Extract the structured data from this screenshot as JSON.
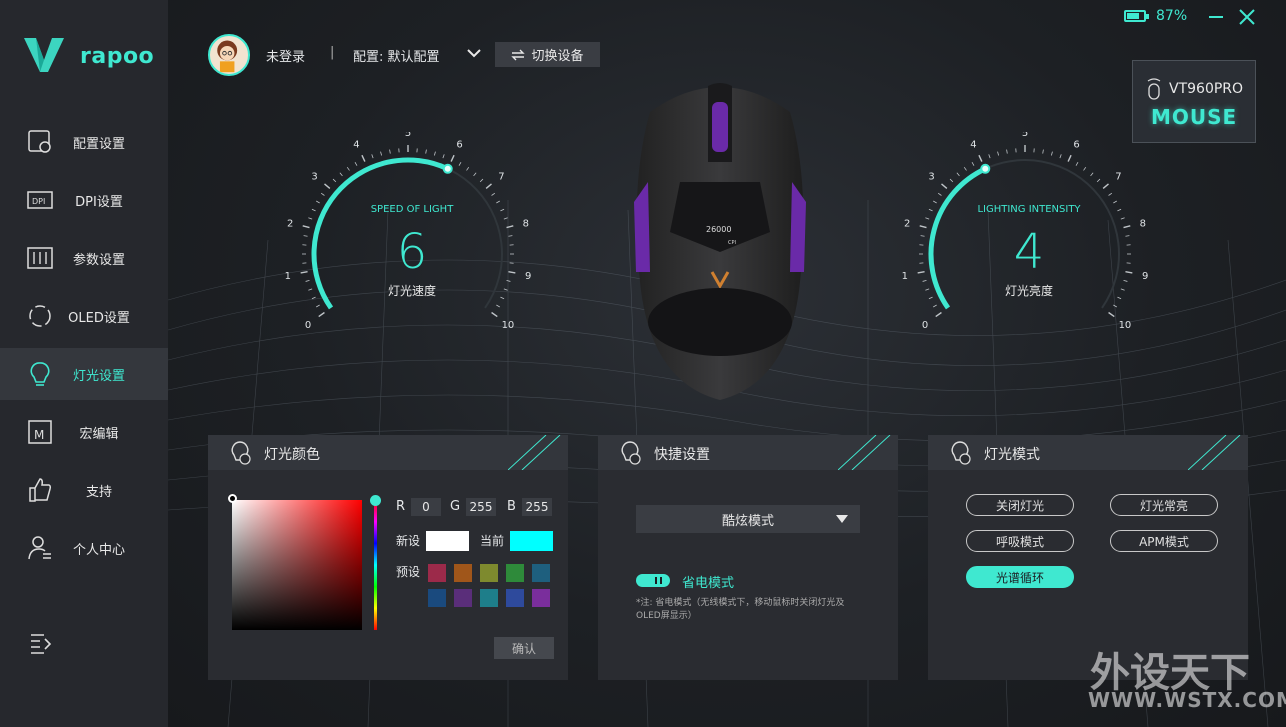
{
  "app": {
    "logo_text": "rapoo"
  },
  "sidebar": {
    "items": [
      {
        "label": "配置设置",
        "icon": "profile-settings-icon"
      },
      {
        "label": "DPI设置",
        "icon": "dpi-icon"
      },
      {
        "label": "参数设置",
        "icon": "sliders-icon"
      },
      {
        "label": "OLED设置",
        "icon": "oled-icon"
      },
      {
        "label": "灯光设置",
        "icon": "bulb-icon",
        "active": true
      },
      {
        "label": "宏编辑",
        "icon": "macro-icon"
      },
      {
        "label": "支持",
        "icon": "thumbs-up-icon"
      },
      {
        "label": "个人中心",
        "icon": "user-icon"
      }
    ]
  },
  "topbar": {
    "battery_pct": "87%",
    "battery_level": 0.87
  },
  "header": {
    "user_name": "未登录",
    "separator": "|",
    "profile_label": "配置: 默认配置",
    "switch_device": "切换设备"
  },
  "device": {
    "model": "VT960PRO",
    "type": "MOUSE"
  },
  "speed_gauge": {
    "title": "SPEED OF LIGHT",
    "value": "6",
    "label": "灯光速度",
    "ticks": [
      "0",
      "1",
      "2",
      "3",
      "4",
      "5",
      "6",
      "7",
      "8",
      "9",
      "10"
    ],
    "level": 6
  },
  "intensity_gauge": {
    "title": "LIGHTING INTENSITY",
    "value": "4",
    "label": "灯光亮度",
    "ticks": [
      "0",
      "1",
      "2",
      "3",
      "4",
      "5",
      "6",
      "7",
      "8",
      "9",
      "10"
    ],
    "level": 4
  },
  "mouse_screen": {
    "dpi": "26000",
    "unit": "CPI"
  },
  "color_panel": {
    "title": "灯光颜色",
    "r_label": "R",
    "r": "0",
    "g_label": "G",
    "g": "255",
    "b_label": "B",
    "b": "255",
    "new_label": "新设",
    "current_label": "当前",
    "new_color": "#ffffff",
    "current_color": "#00ffff",
    "preset_label": "预设",
    "presets": [
      "#9c2a4a",
      "#a0561a",
      "#7e8a2e",
      "#2e8a3a",
      "#1e5f7e",
      "#1a4a7e",
      "#5a2e7a",
      "#1e7e8a",
      "#2e4a9c",
      "#7a2e9c"
    ],
    "confirm": "确认"
  },
  "shortcut_panel": {
    "title": "快捷设置",
    "mode_selected": "酷炫模式",
    "power_save": "省电模式",
    "note": "*注: 省电模式（无线模式下，移动鼠标时关闭灯光及OLED屏显示）"
  },
  "light_mode_panel": {
    "title": "灯光模式",
    "modes": [
      {
        "label": "关闭灯光"
      },
      {
        "label": "灯光常亮"
      },
      {
        "label": "呼吸模式"
      },
      {
        "label": "APM模式"
      },
      {
        "label": "光谱循环",
        "active": true
      }
    ]
  },
  "watermark": {
    "text": "外设天下",
    "url": "WWW.WSTX.COM"
  },
  "colors": {
    "accent": "#3fe8d0"
  }
}
